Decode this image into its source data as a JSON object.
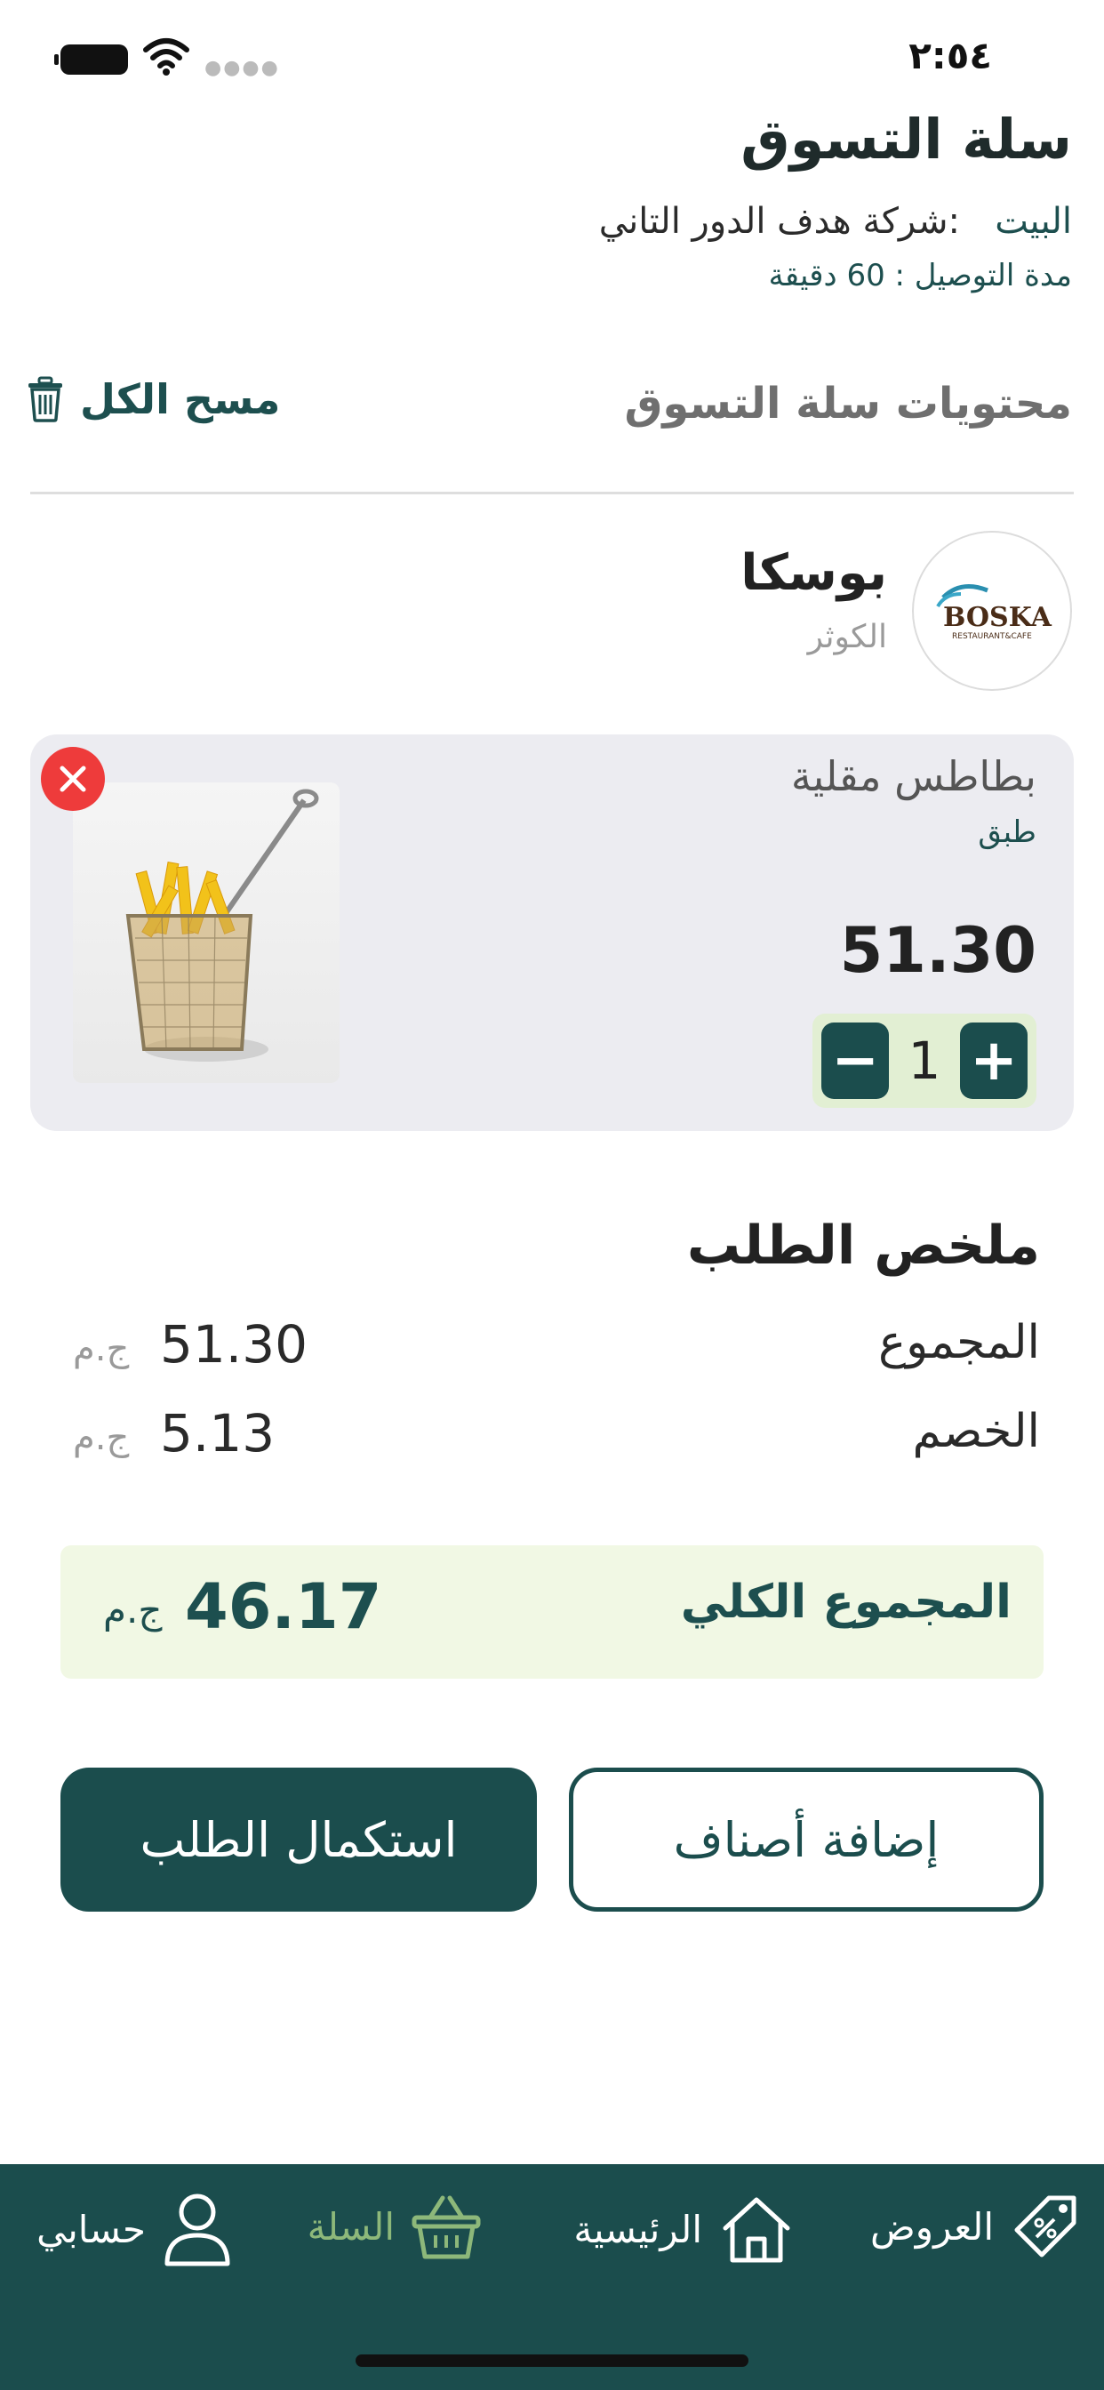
{
  "status_bar": {
    "time": "٢:٥٤"
  },
  "header": {
    "title": "سلة التسوق",
    "address_label": "البيت",
    "address_value": ":شركة هدف الدور التاني",
    "delivery_time": "مدة التوصيل : 60 دقيقة"
  },
  "cart": {
    "contents_title": "محتويات سلة التسوق",
    "clear_all": "مسح الكل"
  },
  "restaurant": {
    "name": "بوسكا",
    "area": "الكوثر",
    "logo_text": "BOSKA",
    "logo_subtext": "RESTAURANT&CAFE"
  },
  "item": {
    "name": "بطاطس مقلية",
    "type": "طبق",
    "price": "51.30",
    "quantity": "1",
    "minus": "−",
    "plus": "+"
  },
  "summary": {
    "title": "ملخص الطلب",
    "subtotal_label": "المجموع",
    "subtotal_value": "51.30",
    "discount_label": "الخصم",
    "discount_value": "5.13",
    "currency": "ج.م",
    "total_label": "المجموع الكلي",
    "total_value": "46.17"
  },
  "actions": {
    "add_items": "إضافة أصناف",
    "checkout": "استكمال الطلب"
  },
  "tabbar": {
    "offers": "العروض",
    "home": "الرئيسية",
    "cart": "السلة",
    "account": "حسابي"
  },
  "colors": {
    "primary": "#1b4d4d",
    "accent_green": "#8db87a",
    "qty_bg": "#e2efd3",
    "total_bg": "#f1f8e4",
    "remove_red": "#ee3b3b"
  }
}
